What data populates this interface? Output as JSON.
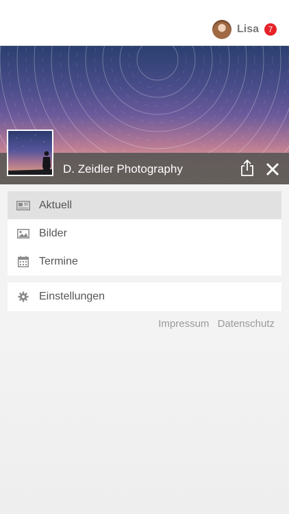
{
  "header": {
    "user_name": "Lisa",
    "notification_count": "7",
    "badge_color": "#e52228"
  },
  "profile": {
    "title": "D. Zeidler Photography",
    "share_icon": "share-icon",
    "close_icon": "close-icon"
  },
  "menu": {
    "items": [
      {
        "label": "Aktuell",
        "icon": "newspaper-icon",
        "active": true
      },
      {
        "label": "Bilder",
        "icon": "image-icon",
        "active": false
      },
      {
        "label": "Termine",
        "icon": "calendar-icon",
        "active": false
      }
    ],
    "settings": {
      "label": "Einstellungen",
      "icon": "gear-icon"
    }
  },
  "footer_links": {
    "impressum": "Impressum",
    "datenschutz": "Datenschutz"
  }
}
